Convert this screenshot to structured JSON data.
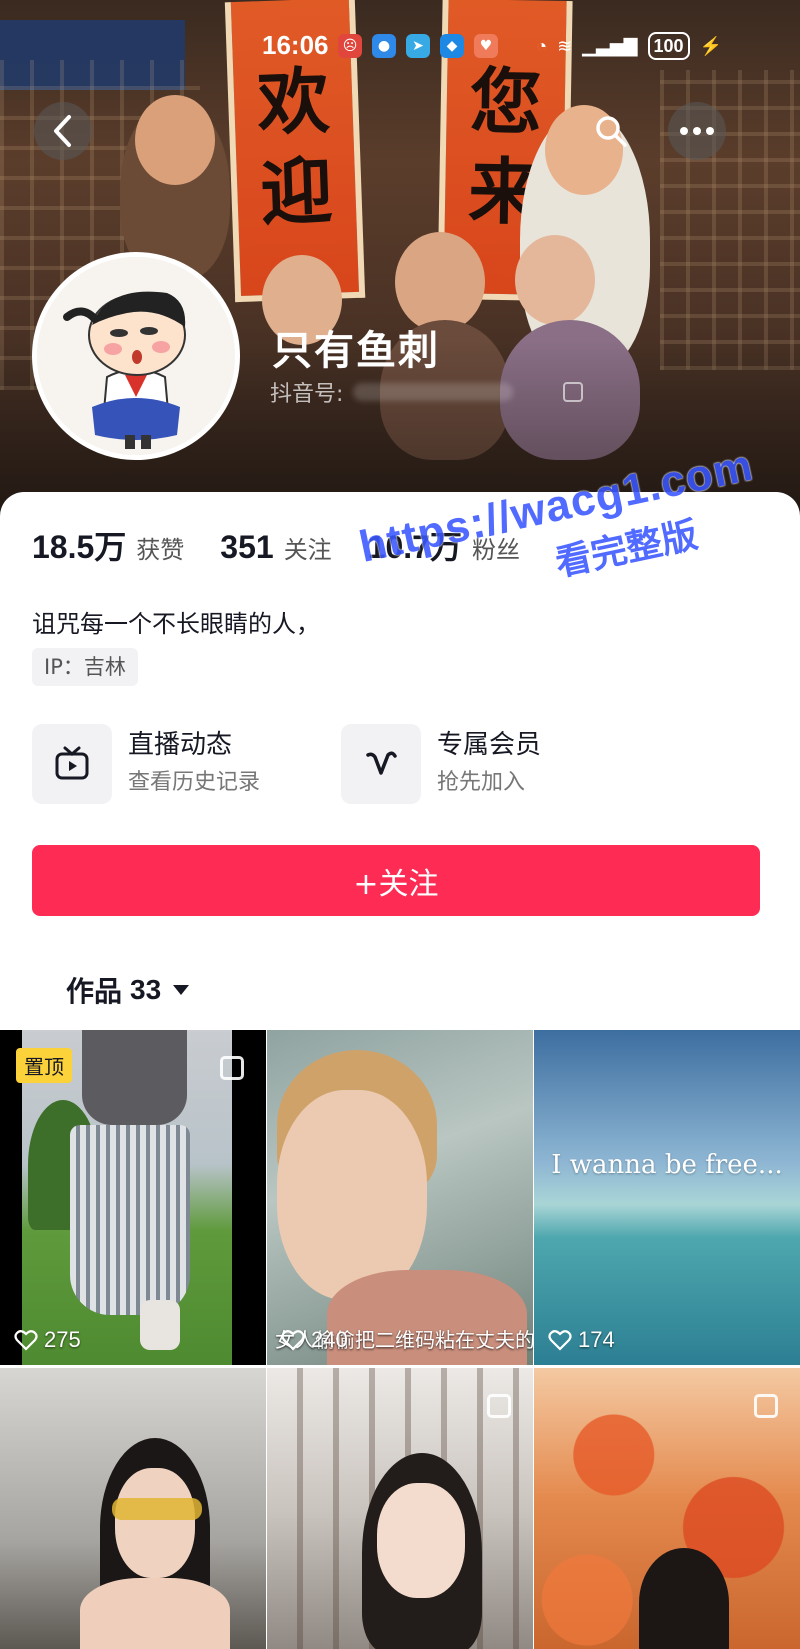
{
  "status_bar": {
    "time": "16:06",
    "battery": "100"
  },
  "header": {
    "banner_text_left": [
      "欢",
      "迎"
    ],
    "banner_text_right": [
      "您",
      "来"
    ]
  },
  "profile": {
    "name": "只有鱼刺",
    "id_label": "抖音号:",
    "bio": "诅咒每一个不长眼睛的人，",
    "ip": "IP：吉林"
  },
  "stats": [
    {
      "value": "18.5万",
      "label": "获赞"
    },
    {
      "value": "351",
      "label": "关注"
    },
    {
      "value": "10.7万",
      "label": "粉丝"
    }
  ],
  "entries": [
    {
      "title": "直播动态",
      "subtitle": "查看历史记录",
      "icon": "tv-icon"
    },
    {
      "title": "专属会员",
      "subtitle": "抢先加入",
      "icon": "v-icon"
    }
  ],
  "follow_button": "+关注",
  "works": {
    "label": "作品",
    "count": "33"
  },
  "watermark": {
    "url": "https://wacg1.com",
    "sub": "看完整版"
  },
  "grid": [
    {
      "likes": "275",
      "pinned": "置顶",
      "multi": true
    },
    {
      "likes": "240",
      "caption": "女人偷偷把二维码粘在丈夫的"
    },
    {
      "likes": "174",
      "overlay_text": "I wanna be free..."
    },
    {
      "multi": false
    },
    {
      "multi": true
    },
    {
      "multi": true
    }
  ],
  "colors": {
    "accent": "#fe2c55",
    "pin_badge": "#fcd23a",
    "watermark": "#3a56ff"
  }
}
